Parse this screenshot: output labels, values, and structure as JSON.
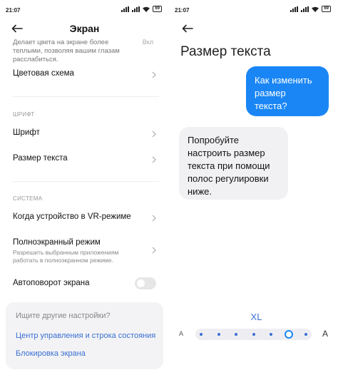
{
  "left_screen": {
    "status": {
      "time": "21:07",
      "battery": "69"
    },
    "header": {
      "title": "Экран"
    },
    "desc": {
      "text": "Делает цвета на экране более теплыми, позволяя вашим глазам расслабиться.",
      "suffix": "Вкл"
    },
    "rows": {
      "color_scheme": "Цветовая схема",
      "font": "Шрифт",
      "text_size": "Размер текста",
      "vr_mode": "Когда устройство в VR-режиме",
      "fullscreen": "Полноэкранный режим",
      "fullscreen_sub": "Разрешить выбранным приложениям работать в полноэкранном режиме.",
      "autorotate": "Автоповорот экрана"
    },
    "sections": {
      "font": "ШРИФТ",
      "system": "СИСТЕМА"
    },
    "autorotate_toggle": {
      "on": false
    },
    "card": {
      "hint": "Ищите другие настройки?",
      "link1": "Центр управления и строка состояния",
      "link2": "Блокировка экрана"
    }
  },
  "right_screen": {
    "status": {
      "time": "21:07",
      "battery": "69"
    },
    "header": {
      "title": "Размер текста"
    },
    "bubble_question": "Как изменить размер текста?",
    "bubble_answer": "Попробуйте настроить размер текста при помощи полос регулировки ниже.",
    "slider": {
      "selected_label": "XL",
      "min_label": "A",
      "max_label": "A",
      "steps": 7,
      "selected_index": 5
    }
  },
  "colors": {
    "accent": "#3a6fd1",
    "bubble_blue": "#1a86f5",
    "bubble_gray": "#f1f1f3"
  }
}
